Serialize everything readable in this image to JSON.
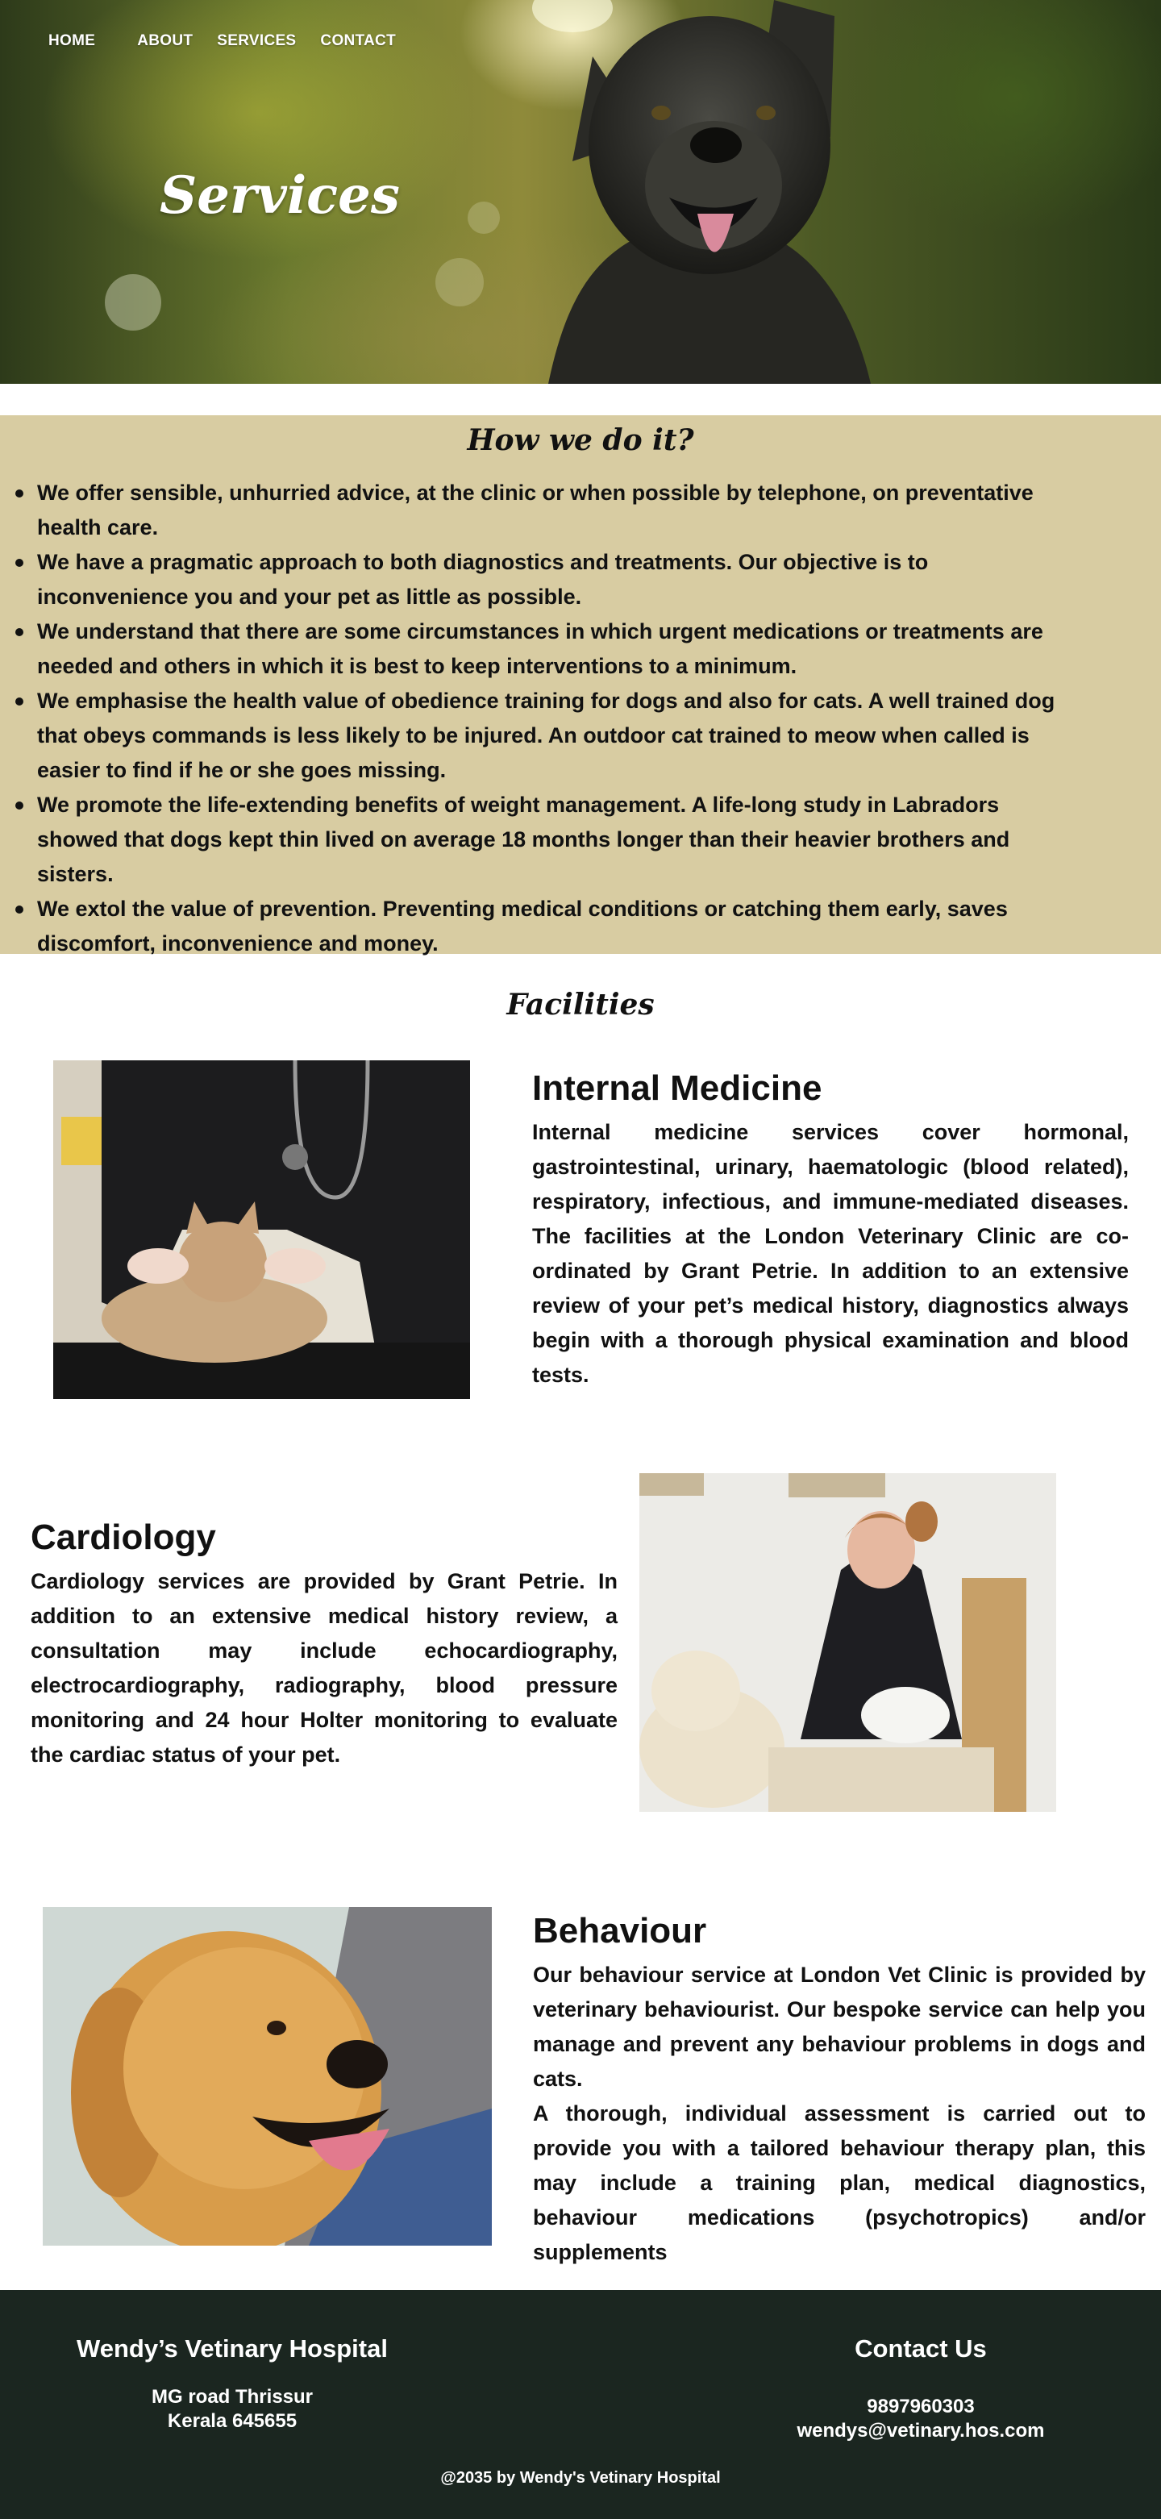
{
  "nav": {
    "items": [
      "HOME",
      "ABOUT",
      "SERVICES",
      "CONTACT"
    ]
  },
  "hero": {
    "title": "Services"
  },
  "how": {
    "title": "How we do it?",
    "items": [
      "We offer sensible, unhurried advice, at the clinic or when possible by telephone, on preventative health care.",
      "We have a pragmatic approach to both diagnostics and treatments. Our objective is to inconvenience you and your pet as little as possible.",
      "We understand that there are some circumstances in which urgent medications or treatments are needed and others in which it is best to keep interventions to a minimum.",
      "We emphasise the health value of obedience training for dogs and also for cats. A well trained dog that obeys commands is less likely to be injured. An outdoor cat trained to meow when called is easier to find if he or she goes missing.",
      "We promote the life-extending benefits of weight management. A life-long study in Labradors showed that dogs kept thin lived on average 18 months longer than their heavier brothers and sisters.",
      "We extol the value of prevention. Preventing medical conditions or catching them early, saves discomfort, inconvenience and money."
    ]
  },
  "facilities": {
    "title": "Facilities",
    "internal": {
      "title": "Internal Medicine",
      "text": "Internal medicine services cover hormonal, gastrointestinal, urinary, haematologic (blood related), respiratory, infectious, and immune-mediated diseases. The facilities at the London Veterinary Clinic are co-ordinated by Grant Petrie. In addition to an extensive review of your pet’s medical history, diagnostics always begin with a thorough physical examination and blood tests."
    },
    "cardiology": {
      "title": "Cardiology",
      "text": "Cardiology services are provided by Grant Petrie. In addition to an extensive medical history review, a consultation may include echocardiography, electrocardiography, radiography, blood pressure monitoring and 24 hour Holter monitoring to evaluate the cardiac status of your pet."
    },
    "behaviour": {
      "title": "Behaviour",
      "text1": "Our behaviour service at London Vet Clinic is provided by veterinary behaviourist. Our bespoke service can help you manage and prevent any behaviour problems in dogs and cats.",
      "text2": "A thorough, individual assessment is carried out to provide you with a tailored behaviour therapy plan, this may include a training plan, medical diagnostics, behaviour medications (psychotropics) and/or supplements"
    }
  },
  "footer": {
    "hospital_title": "Wendy’s Vetinary Hospital",
    "address1": "MG road Thrissur",
    "address2": "Kerala 645655",
    "contact_title": "Contact Us",
    "phone": "9897960303",
    "email": "wendys@vetinary.hos.com",
    "copyright": "@2035 by Wendy's Vetinary Hospital"
  },
  "colors": {
    "how_bg": "#d8cca2",
    "footer_bg": "#1b2620"
  }
}
